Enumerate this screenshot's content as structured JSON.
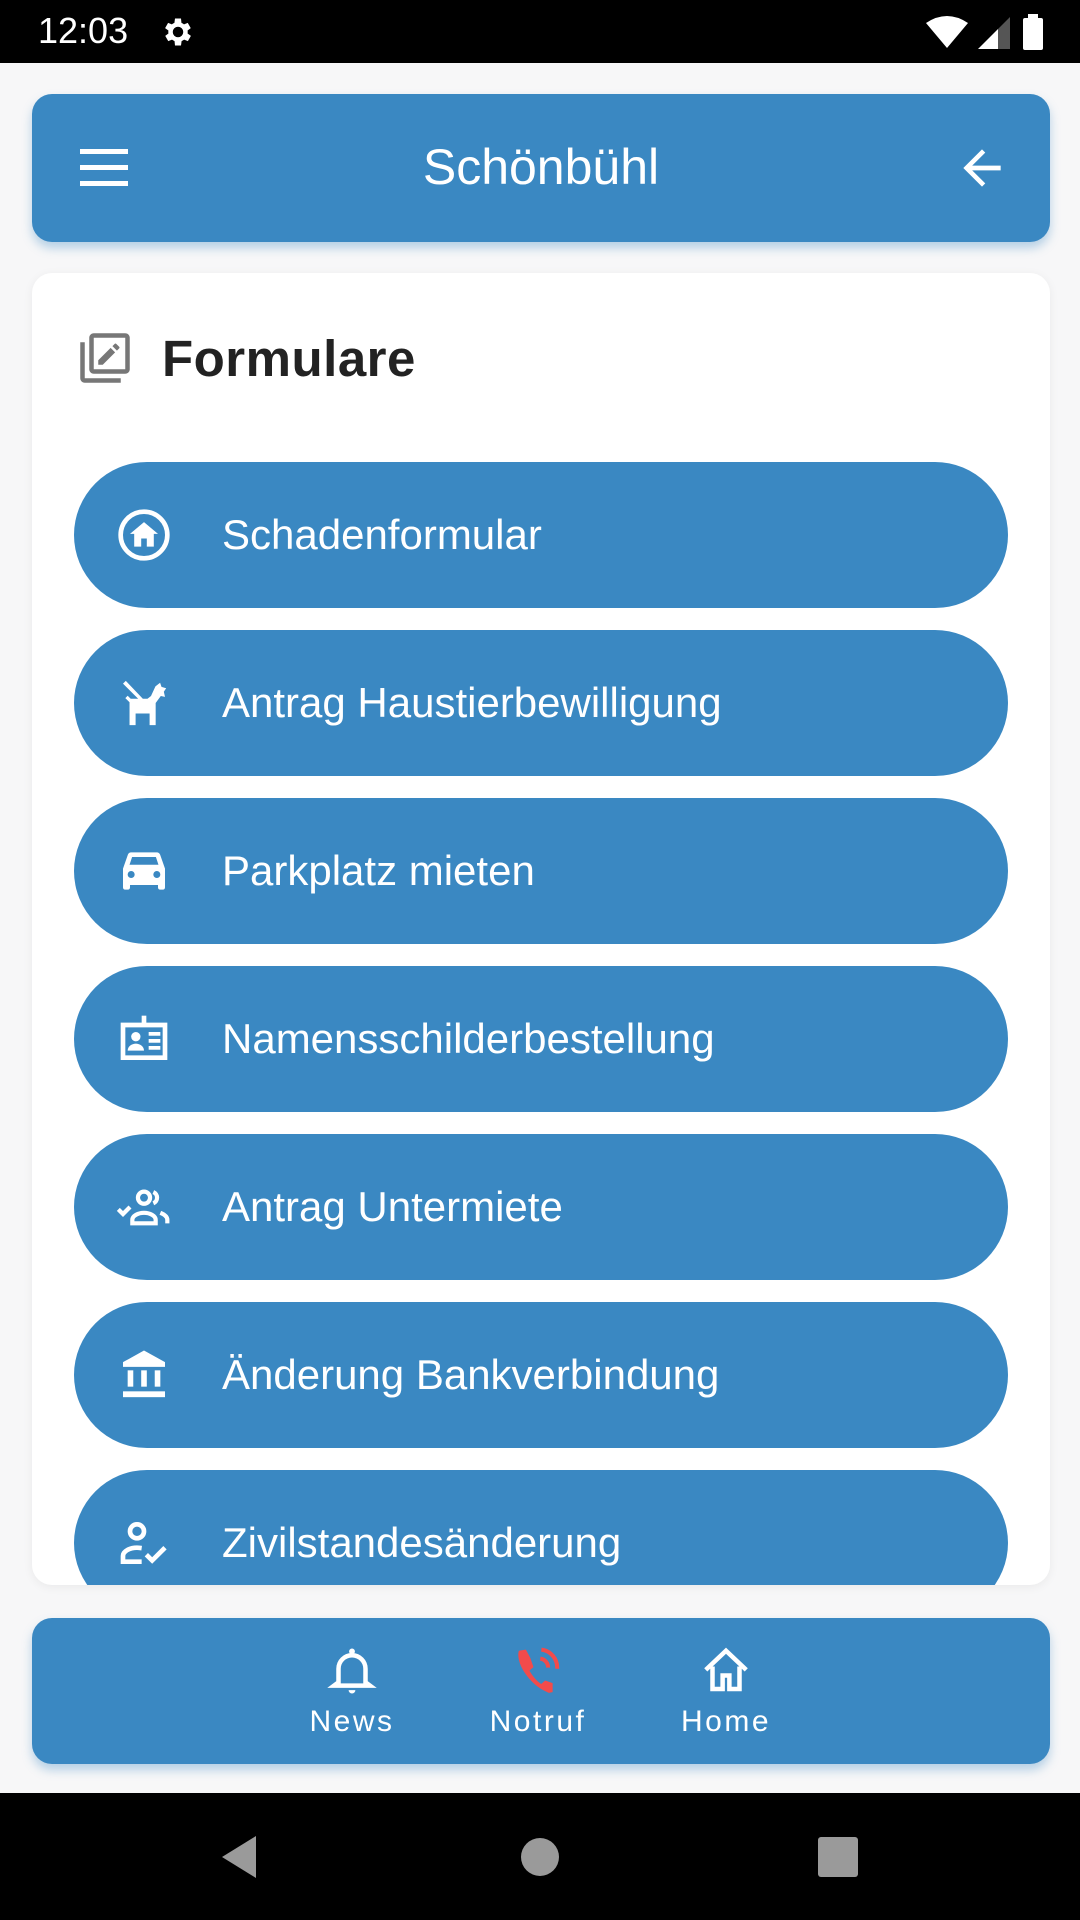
{
  "status_bar": {
    "time": "12:03",
    "icons": [
      "gear-icon",
      "wifi-icon",
      "signal-icon",
      "battery-icon"
    ]
  },
  "header": {
    "title": "Schönbühl",
    "left_icon": "menu-icon",
    "right_icon": "arrow-back-icon"
  },
  "section": {
    "title": "Formulare",
    "icon": "edit-forms-icon"
  },
  "forms": [
    {
      "label": "Schadenformular",
      "icon": "home-circle-icon"
    },
    {
      "label": "Antrag Haustierbewilligung",
      "icon": "dog-leash-icon"
    },
    {
      "label": "Parkplatz mieten",
      "icon": "car-icon"
    },
    {
      "label": "Namensschilderbestellung",
      "icon": "badge-icon"
    },
    {
      "label": "Antrag Untermiete",
      "icon": "group-check-icon"
    },
    {
      "label": "Änderung Bankverbindung",
      "icon": "bank-icon"
    },
    {
      "label": "Zivilstandesänderung",
      "icon": "person-check-icon"
    }
  ],
  "bottom_nav": [
    {
      "label": "News",
      "icon": "bell-icon"
    },
    {
      "label": "Notruf",
      "icon": "phone-ringing-icon",
      "icon_color": "#F24B4B"
    },
    {
      "label": "Home",
      "icon": "home-icon"
    }
  ],
  "colors": {
    "primary": "#3A88C2",
    "emergency": "#F24B4B",
    "background": "#F7F7F8"
  }
}
